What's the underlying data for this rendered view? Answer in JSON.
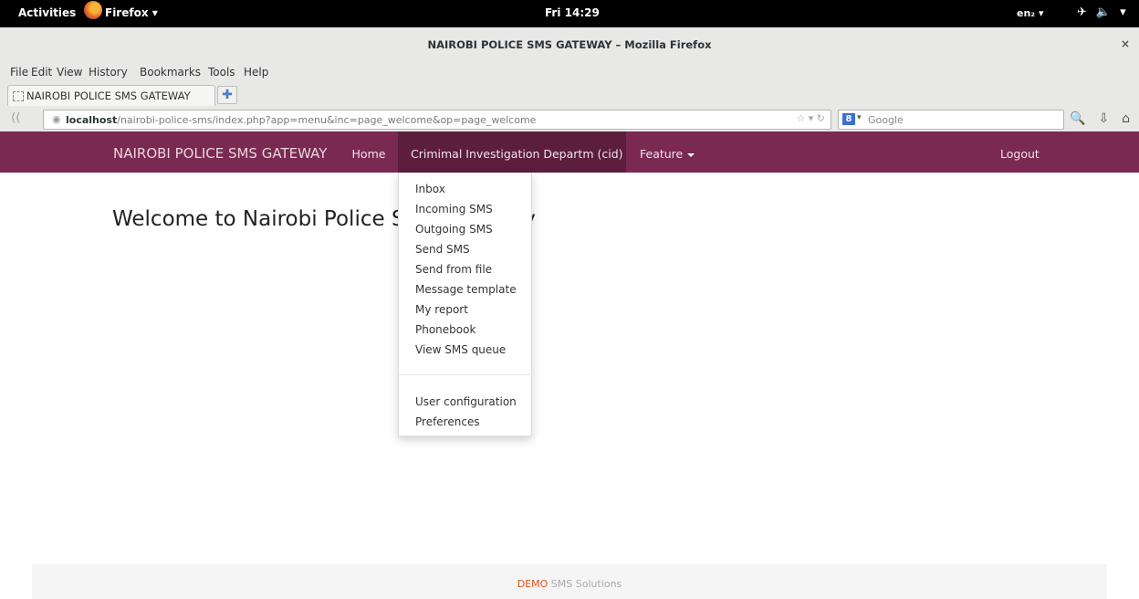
{
  "system_bar": {
    "activities": "Activities",
    "app_name": "Firefox",
    "clock": "Fri 14:29",
    "language": "en₂"
  },
  "window": {
    "title": "NAIROBI POLICE SMS GATEWAY – Mozilla Firefox",
    "close": "×"
  },
  "menu": [
    "File",
    "Edit",
    "View",
    "History",
    "Bookmarks",
    "Tools",
    "Help"
  ],
  "tab": {
    "label": "NAIROBI POLICE SMS GATEWAY"
  },
  "address_bar": {
    "host": "localhost",
    "path": "/nairobi-police-sms/index.php?app=menu&inc=page_welcome&op=page_welcome"
  },
  "search": {
    "placeholder": "Google"
  },
  "app_nav": {
    "brand": "NAIROBI POLICE SMS GATEWAY",
    "home": "Home",
    "cid": "Crimimal Investigation Departm (cid)",
    "feature": "Feature",
    "logout": "Logout"
  },
  "main": {
    "heading": "Welcome to Nairobi Police SMS Gateway"
  },
  "dropdown": {
    "items": [
      "Inbox",
      "Incoming SMS",
      "Outgoing SMS",
      "Send SMS",
      "Send from file",
      "Message template",
      "My report",
      "Phonebook",
      "View SMS queue"
    ],
    "items2": [
      "User configuration",
      "Preferences"
    ]
  },
  "footer": {
    "demo": "DEMO",
    "rest": " SMS Solutions"
  },
  "colors": {
    "navbar": "#7a2952",
    "navbar_active": "#5c1e3d",
    "footer_accent": "#d9541e"
  }
}
